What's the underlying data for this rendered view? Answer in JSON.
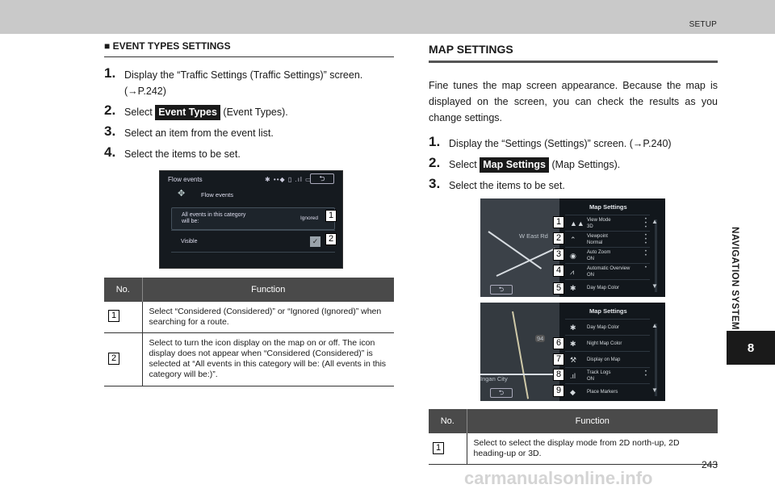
{
  "header": {
    "section": "SETUP"
  },
  "side_tab": {
    "label": "NAVIGATION SYSTEM",
    "number": "8"
  },
  "left": {
    "heading_marker": "■",
    "heading": "EVENT TYPES SETTINGS",
    "steps": [
      {
        "n": "1.",
        "text": "Display the “Traffic Settings (Traffic Settings)” screen. (→P.242)"
      },
      {
        "n": "2.",
        "pre": "Select ",
        "button": "Event Types",
        "post": " (Event Types)."
      },
      {
        "n": "3.",
        "text": "Select an item from the event list."
      },
      {
        "n": "4.",
        "text": "Select the items to be set."
      }
    ],
    "screen": {
      "title": "Flow events",
      "status": "✱ ••◆ ▯ .ıl ▭",
      "back": "⮌",
      "crumb": "Flow events",
      "row1_line1": "All events in this category",
      "row1_line2": "will be:",
      "row1_value": "Ignored",
      "row2": "Visible",
      "check": "✓",
      "callout1": "1",
      "callout2": "2"
    },
    "table": {
      "col_no": "No.",
      "col_function": "Function",
      "rows": [
        {
          "no": "1",
          "function": "Select “Considered (Considered)” or “Ignored (Ignored)” when searching for a route."
        },
        {
          "no": "2",
          "function": "Select to turn the icon display on the map on or off. The icon display does not appear when “Considered (Considered)” is selected at “All events in this category will be: (All events in this category will be:)”."
        }
      ]
    }
  },
  "right": {
    "heading": "MAP SETTINGS",
    "intro": "Fine tunes the map screen appearance. Because the map is displayed on the screen, you can check the results as you change settings.",
    "steps": [
      {
        "n": "1.",
        "text": "Display the “Settings (Settings)” screen. (→P.240)"
      },
      {
        "n": "2.",
        "pre": "Select ",
        "button": "Map Settings",
        "post": " (Map Settings)."
      },
      {
        "n": "3.",
        "text": "Select the items to be set."
      }
    ],
    "screen1": {
      "title": "Map Settings",
      "map_label": "W East Rd",
      "back": "⮌",
      "items": [
        {
          "callout": "1",
          "icon": "▲▲",
          "l1": "View Mode",
          "l2": "3D"
        },
        {
          "callout": "2",
          "icon": "⌃",
          "l1": "Viewpoint",
          "l2": "Normal"
        },
        {
          "callout": "3",
          "icon": "◉",
          "l1": "Auto Zoom",
          "l2": "ON"
        },
        {
          "callout": "4",
          "icon": "⩘",
          "l1": "Automatic Overview",
          "l2": "ON"
        },
        {
          "callout": "5",
          "icon": "✱",
          "l1": "Day Map Color",
          "l2": ""
        }
      ]
    },
    "screen2": {
      "title": "Map Settings",
      "map_label": "Ingan City",
      "map_badge": "94",
      "back": "⮌",
      "items": [
        {
          "callout": "",
          "icon": "✱",
          "l1": "Day Map Color",
          "l2": ""
        },
        {
          "callout": "6",
          "icon": "✱",
          "l1": "Night Map Color",
          "l2": ""
        },
        {
          "callout": "7",
          "icon": "⚒",
          "l1": "Display on Map",
          "l2": ""
        },
        {
          "callout": "8",
          "icon": ".ıl",
          "l1": "Track Logs",
          "l2": "ON"
        },
        {
          "callout": "9",
          "icon": "◆",
          "l1": "Place Markers",
          "l2": ""
        }
      ]
    },
    "table": {
      "col_no": "No.",
      "col_function": "Function",
      "rows": [
        {
          "no": "1",
          "function": "Select to select the display mode from 2D north-up, 2D heading-up or 3D."
        }
      ]
    }
  },
  "page_number": "243",
  "watermark": "carmanualsonline.info"
}
